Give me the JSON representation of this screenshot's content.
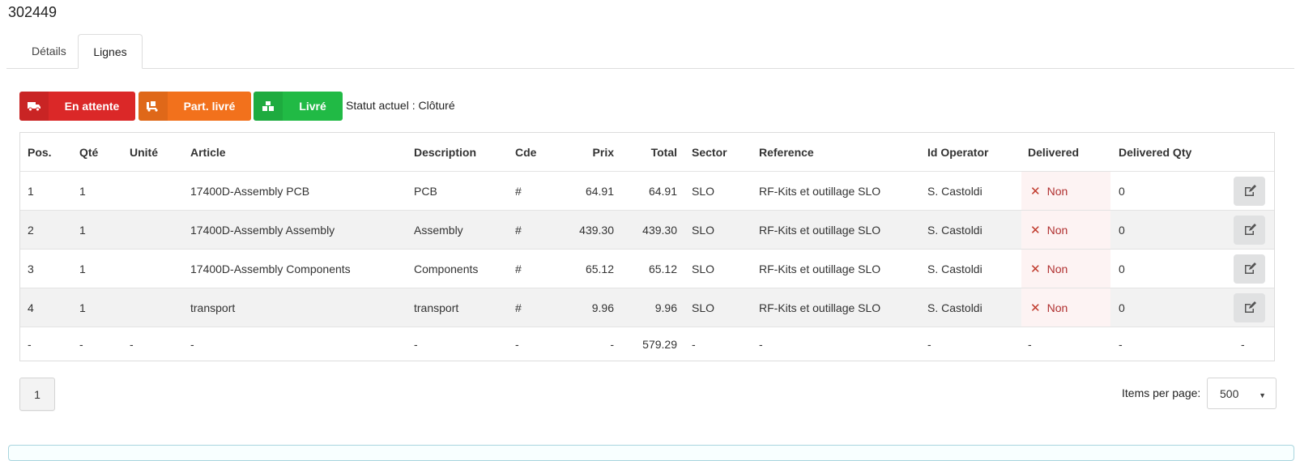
{
  "page": {
    "title": "302449"
  },
  "tabs": [
    {
      "label": "Détails",
      "active": false
    },
    {
      "label": "Lignes",
      "active": true
    }
  ],
  "status_buttons": {
    "pending": {
      "label": "En attente",
      "icon": "truck-icon",
      "color": "#db2828"
    },
    "partial": {
      "label": "Part. livré",
      "icon": "partial-delivery-icon",
      "color": "#f2711c"
    },
    "delivered": {
      "label": "Livré",
      "icon": "boxes-icon",
      "color": "#21ba45"
    }
  },
  "current_status": "Statut actuel : Clôturé",
  "table": {
    "headers": {
      "pos": "Pos.",
      "qte": "Qté",
      "unite": "Unité",
      "article": "Article",
      "description": "Description",
      "cde": "Cde",
      "prix": "Prix",
      "total": "Total",
      "sector": "Sector",
      "reference": "Reference",
      "id_operator": "Id Operator",
      "delivered": "Delivered",
      "delivered_qty": "Delivered Qty"
    },
    "rows": [
      {
        "pos": "1",
        "qte": "1",
        "unite": "",
        "article": "17400D-Assembly PCB",
        "description": "PCB",
        "cde": "#",
        "prix": "64.91",
        "total": "64.91",
        "sector": "SLO",
        "reference": "RF-Kits et outillage SLO",
        "id_operator": "S. Castoldi",
        "delivered": "Non",
        "delivered_qty": "0"
      },
      {
        "pos": "2",
        "qte": "1",
        "unite": "",
        "article": "17400D-Assembly Assembly",
        "description": "Assembly",
        "cde": "#",
        "prix": "439.30",
        "total": "439.30",
        "sector": "SLO",
        "reference": "RF-Kits et outillage SLO",
        "id_operator": "S. Castoldi",
        "delivered": "Non",
        "delivered_qty": "0"
      },
      {
        "pos": "3",
        "qte": "1",
        "unite": "",
        "article": "17400D-Assembly Components",
        "description": "Components",
        "cde": "#",
        "prix": "65.12",
        "total": "65.12",
        "sector": "SLO",
        "reference": "RF-Kits et outillage SLO",
        "id_operator": "S. Castoldi",
        "delivered": "Non",
        "delivered_qty": "0"
      },
      {
        "pos": "4",
        "qte": "1",
        "unite": "",
        "article": "transport",
        "description": "transport",
        "cde": "#",
        "prix": "9.96",
        "total": "9.96",
        "sector": "SLO",
        "reference": "RF-Kits et outillage SLO",
        "id_operator": "S. Castoldi",
        "delivered": "Non",
        "delivered_qty": "0"
      }
    ],
    "footer": {
      "pos": "-",
      "qte": "-",
      "unite": "-",
      "article": "-",
      "description": "-",
      "cde": "-",
      "prix": "-",
      "total": "579.29",
      "sector": "-",
      "reference": "-",
      "id_operator": "-",
      "delivered": "-",
      "delivered_qty": "-",
      "edit": "-"
    }
  },
  "pagination": {
    "current_page": "1",
    "items_per_page_label": "Items per page:",
    "items_per_page": "500"
  }
}
